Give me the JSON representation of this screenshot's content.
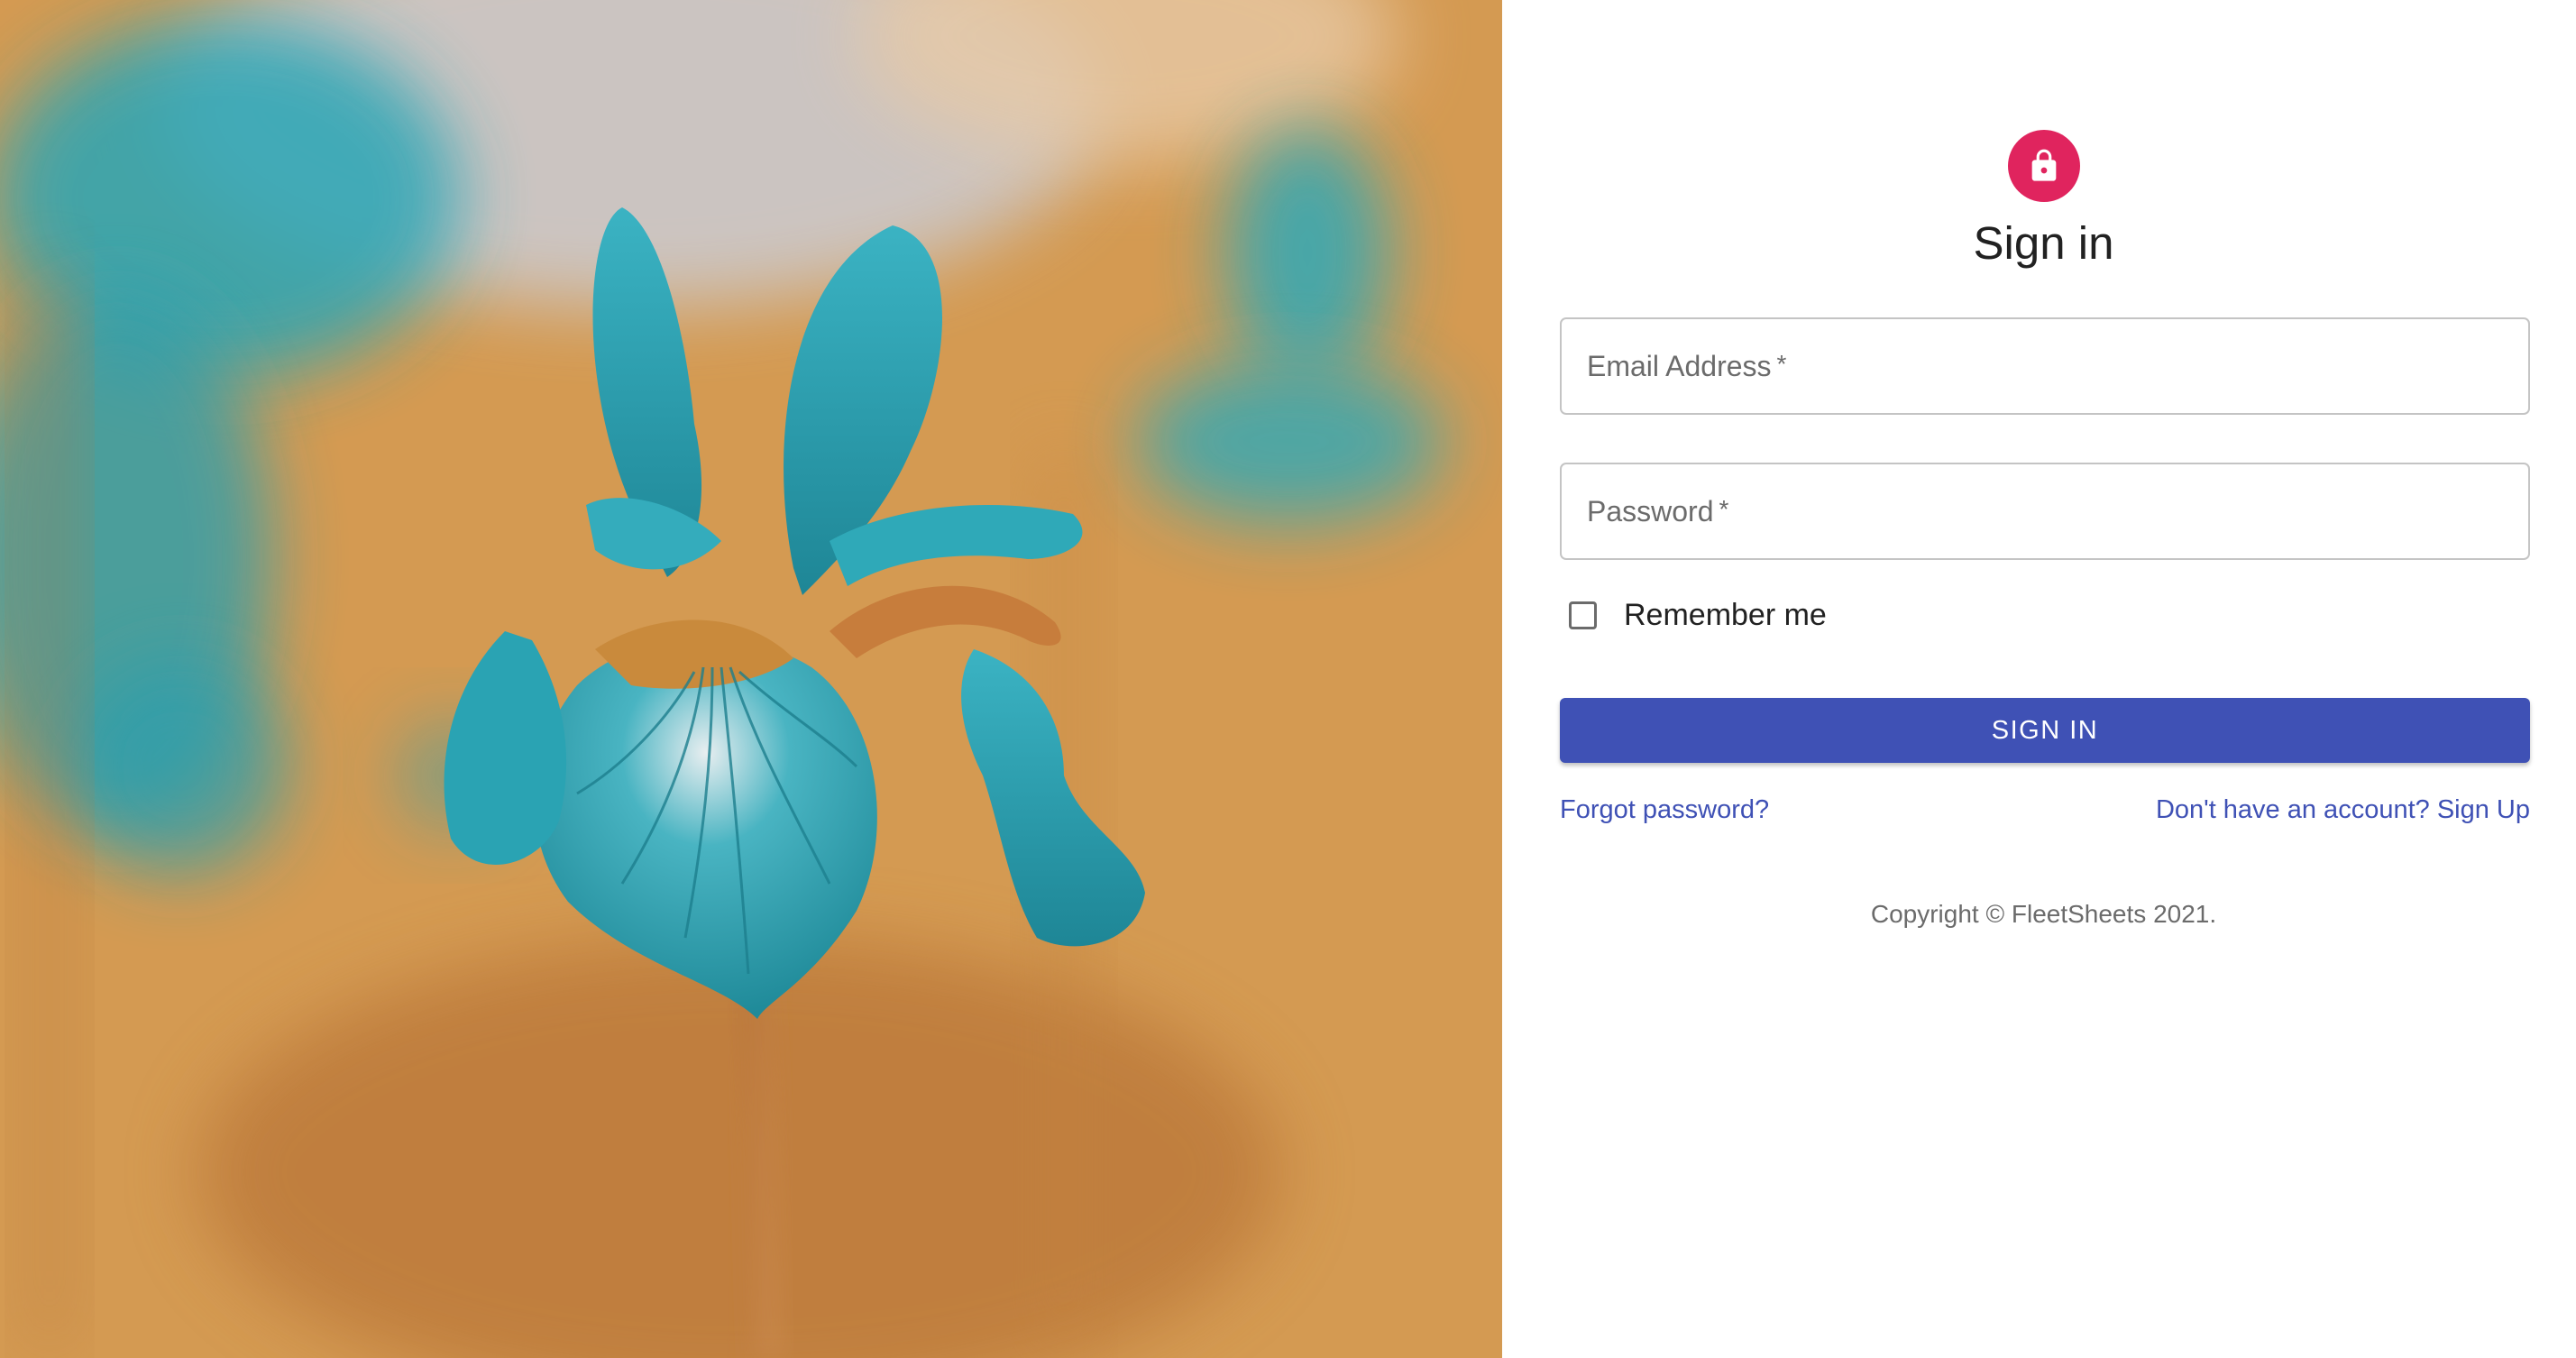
{
  "hero": {
    "image_icon": "iris-flower-photo",
    "colors": {
      "background": "#d8a55e",
      "petal": "#2fa9b8"
    }
  },
  "form": {
    "lock_icon": "lock-icon",
    "title": "Sign in",
    "email": {
      "label": "Email Address",
      "required_mark": "*",
      "value": ""
    },
    "password": {
      "label": "Password",
      "required_mark": "*",
      "value": ""
    },
    "remember_label": "Remember me",
    "remember_checked": false,
    "submit_label": "SIGN IN",
    "forgot_link": "Forgot password?",
    "signup_link": "Don't have an account? Sign Up",
    "copyright": "Copyright © FleetSheets 2021."
  },
  "colors": {
    "accent": "#3f51b5",
    "avatar": "#e0245e",
    "text": "#212121",
    "muted": "#6b6b6b"
  }
}
